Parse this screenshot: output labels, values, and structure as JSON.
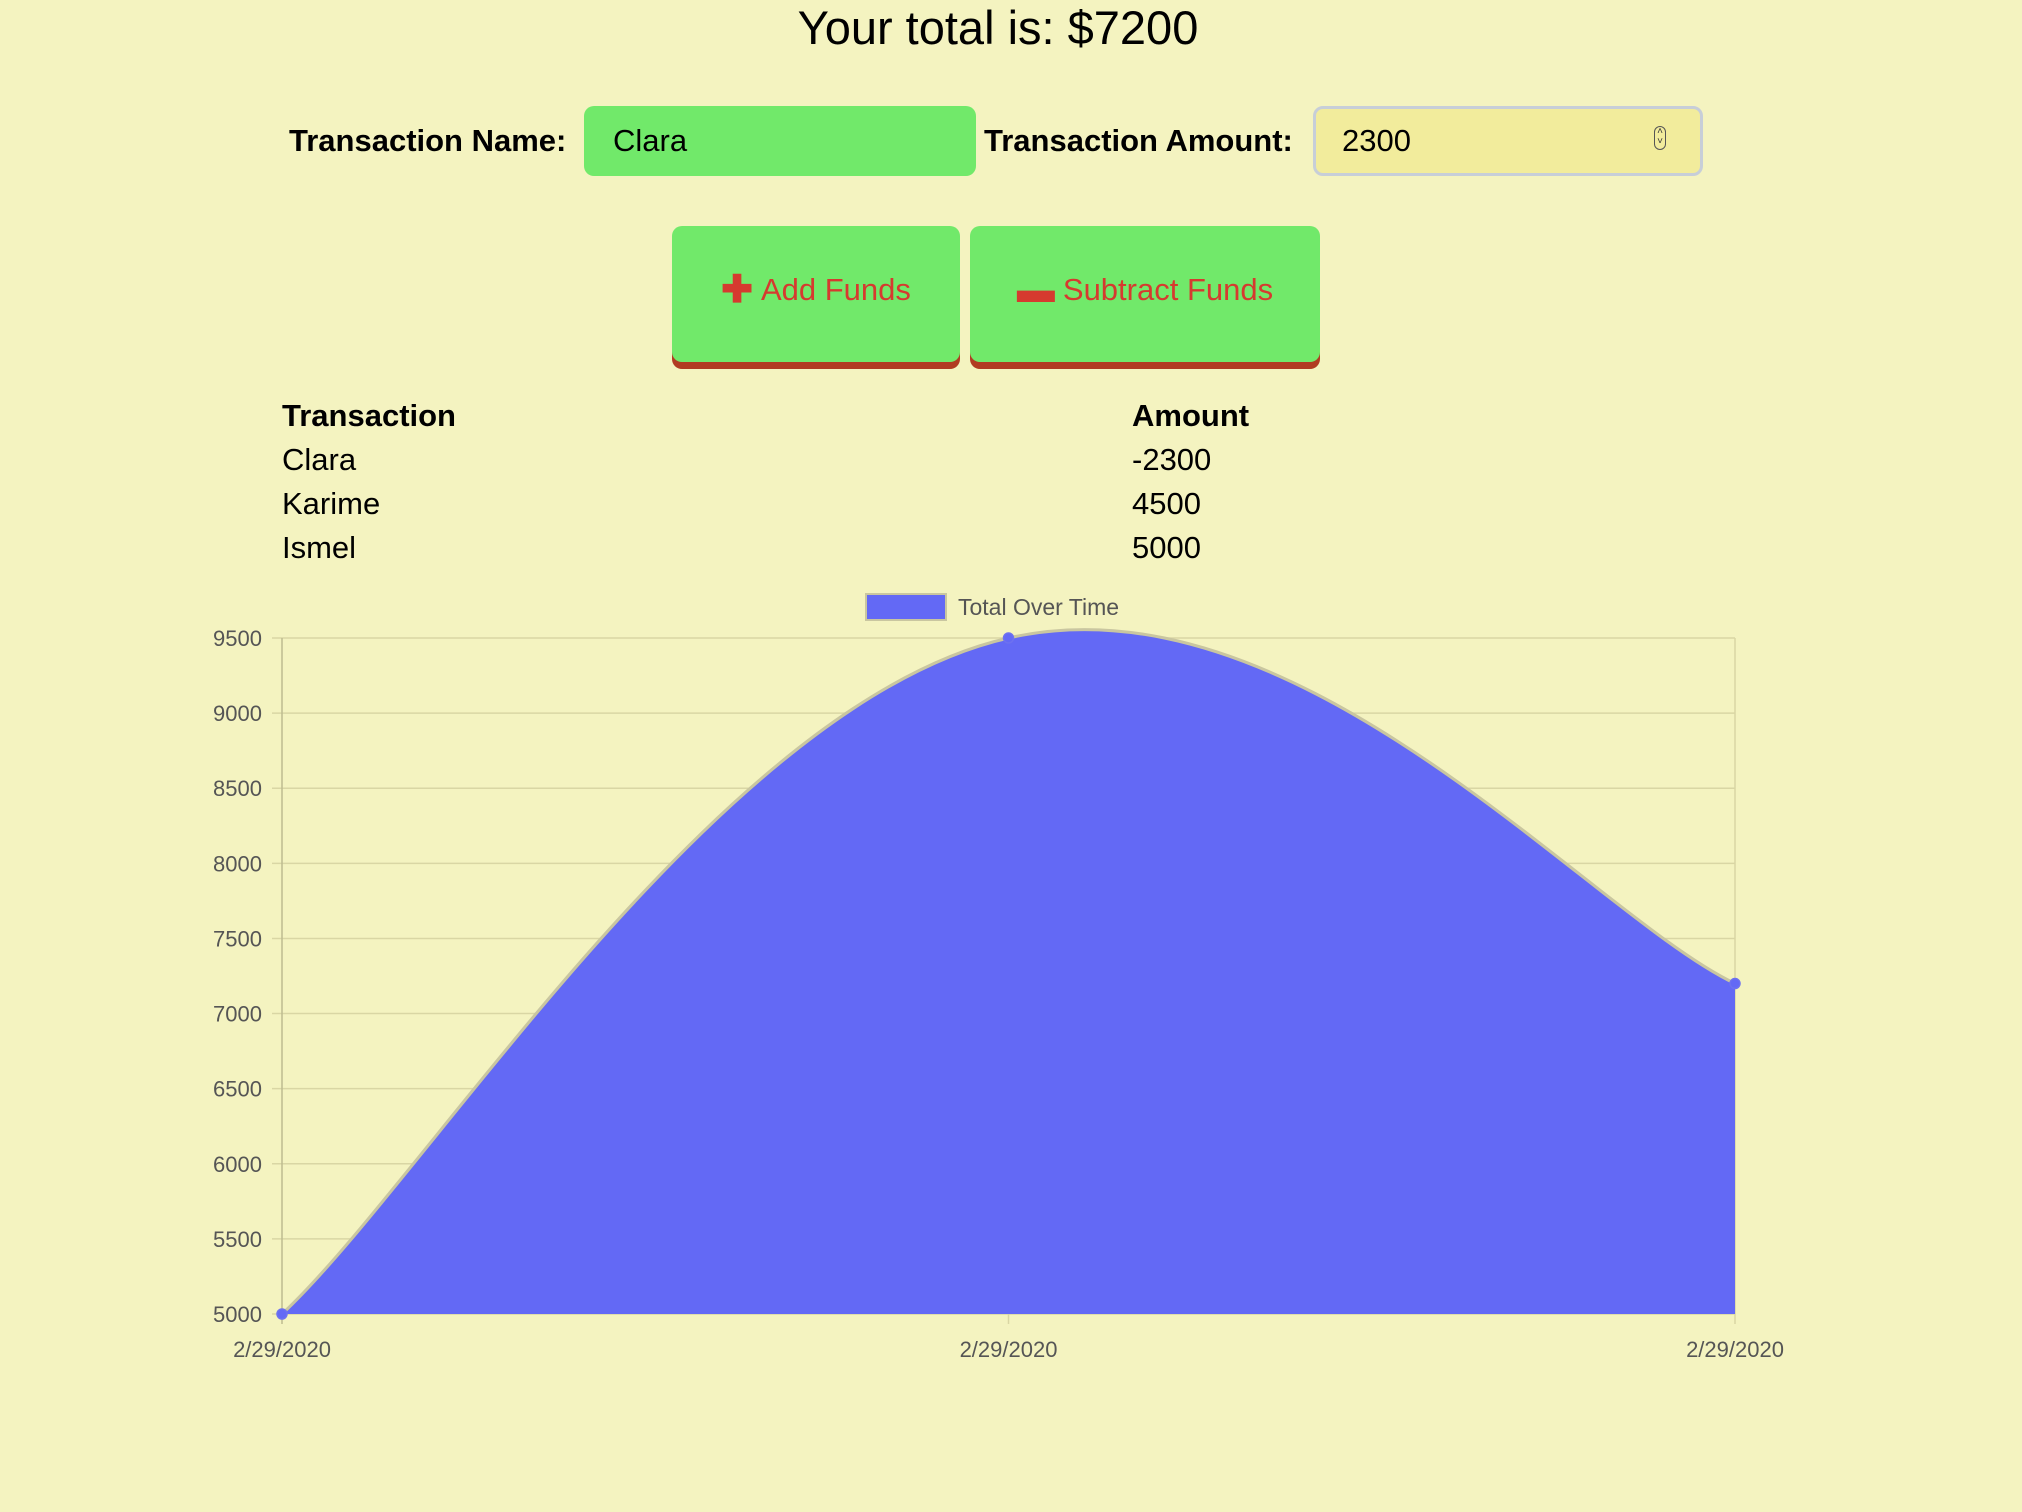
{
  "header": {
    "total_text": "Your total is: $7200"
  },
  "form": {
    "name_label": "Transaction Name:",
    "name_value": "Clara",
    "amount_label": "Transaction Amount:",
    "amount_value": "2300"
  },
  "buttons": {
    "add_label": "Add Funds",
    "add_icon": "plus-icon",
    "subtract_label": "Subtract Funds",
    "subtract_icon": "minus-icon"
  },
  "table": {
    "headers": [
      "Transaction",
      "Amount"
    ],
    "rows": [
      [
        "Clara",
        "-2300"
      ],
      [
        "Karime",
        "4500"
      ],
      [
        "Ismel",
        "5000"
      ]
    ]
  },
  "colors": {
    "background": "#f4f3c0",
    "accent_green": "#71e96a",
    "button_text": "#d63a2f",
    "area_fill": "#6369f5"
  },
  "chart_data": {
    "type": "area",
    "legend": "Total Over Time",
    "legend_position": "top",
    "categories": [
      "2/29/2020",
      "2/29/2020",
      "2/29/2020"
    ],
    "series": [
      {
        "name": "Total Over Time",
        "values": [
          5000,
          9500,
          7200
        ]
      }
    ],
    "ylim": [
      5000,
      9500
    ],
    "yticks": [
      5000,
      5500,
      6000,
      6500,
      7000,
      7500,
      8000,
      8500,
      9000,
      9500
    ],
    "grid": true
  }
}
